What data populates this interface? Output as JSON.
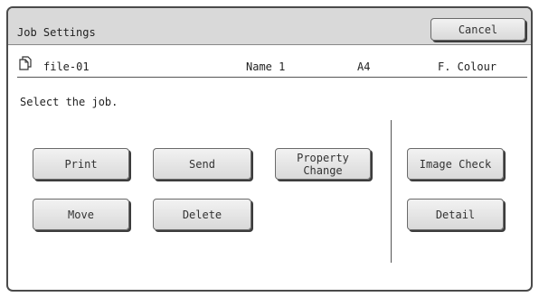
{
  "window": {
    "title": "Job Settings"
  },
  "toolbar": {
    "cancel_label": "Cancel"
  },
  "file": {
    "icon": "file-copy-icon",
    "name": "file-01",
    "user": "Name 1",
    "paper_size": "A4",
    "color_mode": "F. Colour"
  },
  "main": {
    "prompt": "Select the job.",
    "buttons": {
      "print": "Print",
      "send": "Send",
      "property_change": "Property\nChange",
      "image_check": "Image Check",
      "move": "Move",
      "delete": "Delete",
      "detail": "Detail"
    }
  }
}
